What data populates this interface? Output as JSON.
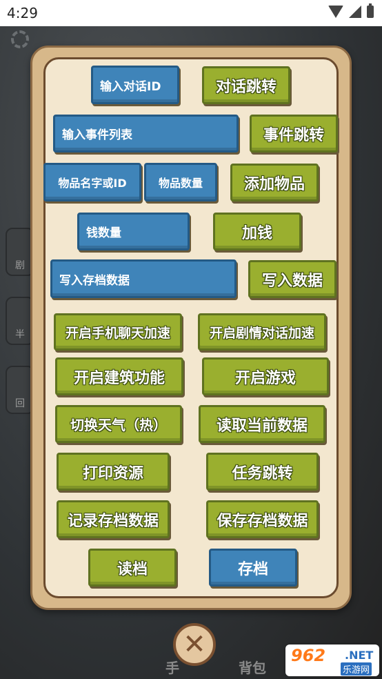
{
  "status_bar": {
    "time": "4:29"
  },
  "background": {
    "side_tabs": [
      "剧",
      "半",
      "回"
    ],
    "bottom_labels": [
      "手",
      "背包"
    ]
  },
  "dialog": {
    "dialog_id_input": "输入对话ID",
    "dialog_jump": "对话跳转",
    "event_list_input": "输入事件列表",
    "event_jump": "事件跳转",
    "item_name_input": "物品名字或ID",
    "item_count_input": "物品数量",
    "add_item": "添加物品",
    "money_input": "钱数量",
    "add_money": "加钱",
    "save_data_input": "写入存档数据",
    "write_data": "写入数据",
    "phone_chat_speed": "开启手机聊天加速",
    "story_dialog_speed": "开启剧情对话加速",
    "building_feature": "开启建筑功能",
    "start_game": "开启游戏",
    "switch_weather": "切换天气（热）",
    "read_current_data": "读取当前数据",
    "print_resources": "打印资源",
    "task_jump": "任务跳转",
    "record_save_data": "记录存档数据",
    "keep_save_data": "保存存档数据",
    "load": "读档",
    "save": "存档"
  },
  "colors": {
    "green_button": "#9aaf2f",
    "blue_button": "#3f84b9",
    "panel": "#f3e7cf"
  },
  "watermark": {
    "brand": "962",
    "tld": ".NET",
    "sub": "乐游网"
  }
}
